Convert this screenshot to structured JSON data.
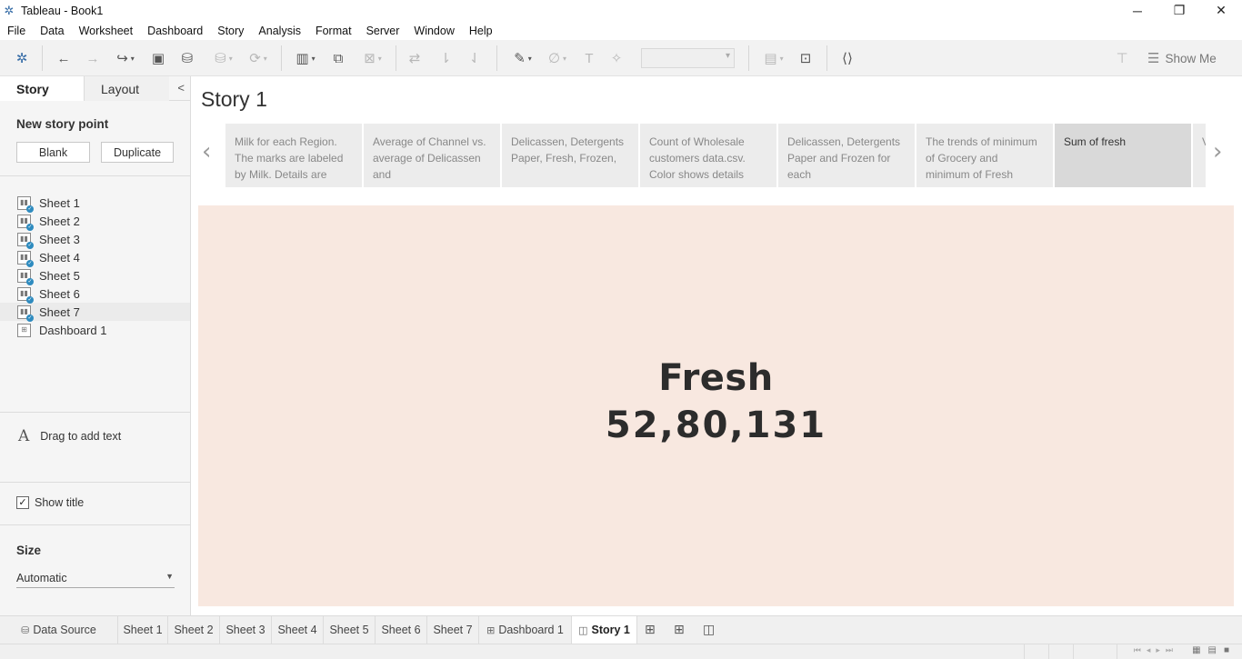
{
  "window": {
    "title": "Tableau - Book1",
    "minimize": "─",
    "restore": "❐",
    "close": "✕"
  },
  "menu": [
    "File",
    "Data",
    "Worksheet",
    "Dashboard",
    "Story",
    "Analysis",
    "Format",
    "Server",
    "Window",
    "Help"
  ],
  "toolbar": {
    "show_me_label": "Show Me"
  },
  "left_panel": {
    "tabs": {
      "story": "Story",
      "layout": "Layout"
    },
    "new_story_point": "New story point",
    "blank_button": "Blank",
    "duplicate_button": "Duplicate",
    "sheets": [
      "Sheet 1",
      "Sheet 2",
      "Sheet 3",
      "Sheet 4",
      "Sheet 5",
      "Sheet 6",
      "Sheet 7",
      "Dashboard 1"
    ],
    "drag_text": "Drag to add text",
    "show_title": "Show title",
    "size_label": "Size",
    "size_value": "Automatic"
  },
  "story": {
    "title": "Story 1",
    "points": [
      "Milk for each Region. The marks are labeled by Milk.  Details are",
      "Average of Channel vs. average of Delicassen and",
      "Delicassen, Detergents Paper, Fresh, Frozen,",
      "Count of Wholesale customers data.csv. Color shows details",
      "Delicassen, Detergents Paper and Frozen for each",
      "The trends of minimum of Grocery and minimum of Fresh",
      "Sum of fresh",
      "V a"
    ],
    "active_point": 6,
    "kpi_name": "Fresh",
    "kpi_value": "52,80,131"
  },
  "bottom_tabs": {
    "data_source": "Data Source",
    "sheets": [
      "Sheet 1",
      "Sheet 2",
      "Sheet 3",
      "Sheet 4",
      "Sheet 5",
      "Sheet 6",
      "Sheet 7"
    ],
    "dashboard": "Dashboard 1",
    "story": "Story 1"
  },
  "colors": {
    "canvas_bg": "#f8e8e0",
    "kpi_text": "#2c2c2c",
    "accent": "#2e8bbf"
  }
}
